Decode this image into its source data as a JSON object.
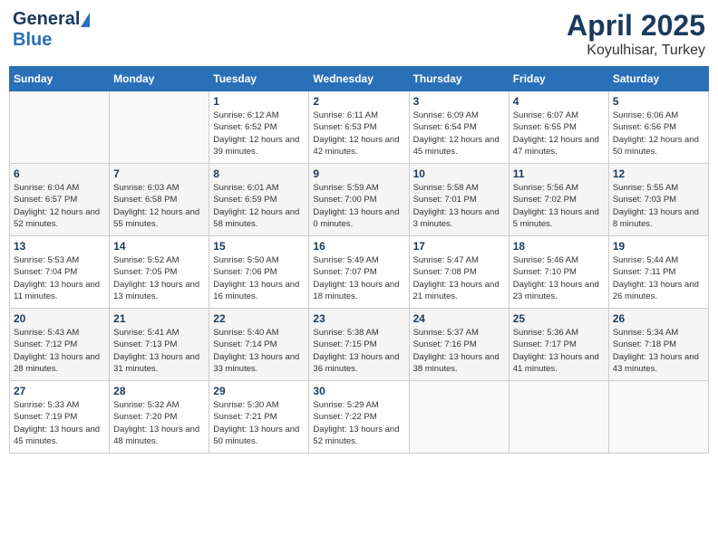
{
  "header": {
    "logo_general": "General",
    "logo_blue": "Blue",
    "month": "April 2025",
    "location": "Koyulhisar, Turkey"
  },
  "days_of_week": [
    "Sunday",
    "Monday",
    "Tuesday",
    "Wednesday",
    "Thursday",
    "Friday",
    "Saturday"
  ],
  "weeks": [
    [
      {
        "day": "",
        "info": ""
      },
      {
        "day": "",
        "info": ""
      },
      {
        "day": "1",
        "info": "Sunrise: 6:12 AM\nSunset: 6:52 PM\nDaylight: 12 hours and 39 minutes."
      },
      {
        "day": "2",
        "info": "Sunrise: 6:11 AM\nSunset: 6:53 PM\nDaylight: 12 hours and 42 minutes."
      },
      {
        "day": "3",
        "info": "Sunrise: 6:09 AM\nSunset: 6:54 PM\nDaylight: 12 hours and 45 minutes."
      },
      {
        "day": "4",
        "info": "Sunrise: 6:07 AM\nSunset: 6:55 PM\nDaylight: 12 hours and 47 minutes."
      },
      {
        "day": "5",
        "info": "Sunrise: 6:06 AM\nSunset: 6:56 PM\nDaylight: 12 hours and 50 minutes."
      }
    ],
    [
      {
        "day": "6",
        "info": "Sunrise: 6:04 AM\nSunset: 6:57 PM\nDaylight: 12 hours and 52 minutes."
      },
      {
        "day": "7",
        "info": "Sunrise: 6:03 AM\nSunset: 6:58 PM\nDaylight: 12 hours and 55 minutes."
      },
      {
        "day": "8",
        "info": "Sunrise: 6:01 AM\nSunset: 6:59 PM\nDaylight: 12 hours and 58 minutes."
      },
      {
        "day": "9",
        "info": "Sunrise: 5:59 AM\nSunset: 7:00 PM\nDaylight: 13 hours and 0 minutes."
      },
      {
        "day": "10",
        "info": "Sunrise: 5:58 AM\nSunset: 7:01 PM\nDaylight: 13 hours and 3 minutes."
      },
      {
        "day": "11",
        "info": "Sunrise: 5:56 AM\nSunset: 7:02 PM\nDaylight: 13 hours and 5 minutes."
      },
      {
        "day": "12",
        "info": "Sunrise: 5:55 AM\nSunset: 7:03 PM\nDaylight: 13 hours and 8 minutes."
      }
    ],
    [
      {
        "day": "13",
        "info": "Sunrise: 5:53 AM\nSunset: 7:04 PM\nDaylight: 13 hours and 11 minutes."
      },
      {
        "day": "14",
        "info": "Sunrise: 5:52 AM\nSunset: 7:05 PM\nDaylight: 13 hours and 13 minutes."
      },
      {
        "day": "15",
        "info": "Sunrise: 5:50 AM\nSunset: 7:06 PM\nDaylight: 13 hours and 16 minutes."
      },
      {
        "day": "16",
        "info": "Sunrise: 5:49 AM\nSunset: 7:07 PM\nDaylight: 13 hours and 18 minutes."
      },
      {
        "day": "17",
        "info": "Sunrise: 5:47 AM\nSunset: 7:08 PM\nDaylight: 13 hours and 21 minutes."
      },
      {
        "day": "18",
        "info": "Sunrise: 5:46 AM\nSunset: 7:10 PM\nDaylight: 13 hours and 23 minutes."
      },
      {
        "day": "19",
        "info": "Sunrise: 5:44 AM\nSunset: 7:11 PM\nDaylight: 13 hours and 26 minutes."
      }
    ],
    [
      {
        "day": "20",
        "info": "Sunrise: 5:43 AM\nSunset: 7:12 PM\nDaylight: 13 hours and 28 minutes."
      },
      {
        "day": "21",
        "info": "Sunrise: 5:41 AM\nSunset: 7:13 PM\nDaylight: 13 hours and 31 minutes."
      },
      {
        "day": "22",
        "info": "Sunrise: 5:40 AM\nSunset: 7:14 PM\nDaylight: 13 hours and 33 minutes."
      },
      {
        "day": "23",
        "info": "Sunrise: 5:38 AM\nSunset: 7:15 PM\nDaylight: 13 hours and 36 minutes."
      },
      {
        "day": "24",
        "info": "Sunrise: 5:37 AM\nSunset: 7:16 PM\nDaylight: 13 hours and 38 minutes."
      },
      {
        "day": "25",
        "info": "Sunrise: 5:36 AM\nSunset: 7:17 PM\nDaylight: 13 hours and 41 minutes."
      },
      {
        "day": "26",
        "info": "Sunrise: 5:34 AM\nSunset: 7:18 PM\nDaylight: 13 hours and 43 minutes."
      }
    ],
    [
      {
        "day": "27",
        "info": "Sunrise: 5:33 AM\nSunset: 7:19 PM\nDaylight: 13 hours and 45 minutes."
      },
      {
        "day": "28",
        "info": "Sunrise: 5:32 AM\nSunset: 7:20 PM\nDaylight: 13 hours and 48 minutes."
      },
      {
        "day": "29",
        "info": "Sunrise: 5:30 AM\nSunset: 7:21 PM\nDaylight: 13 hours and 50 minutes."
      },
      {
        "day": "30",
        "info": "Sunrise: 5:29 AM\nSunset: 7:22 PM\nDaylight: 13 hours and 52 minutes."
      },
      {
        "day": "",
        "info": ""
      },
      {
        "day": "",
        "info": ""
      },
      {
        "day": "",
        "info": ""
      }
    ]
  ]
}
